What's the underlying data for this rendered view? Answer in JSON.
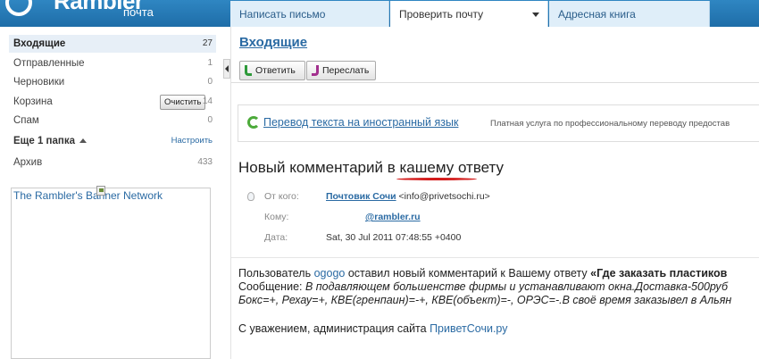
{
  "header": {
    "logo_word": "Rambler",
    "logo_sub": "почта",
    "tabs": {
      "write": "Написать письмо",
      "check": "Проверить почту",
      "address": "Адресная книга"
    }
  },
  "sidebar": {
    "folders": [
      {
        "label": "Входящие",
        "count": "27"
      },
      {
        "label": "Отправленные",
        "count": "1"
      },
      {
        "label": "Черновики",
        "count": "0"
      },
      {
        "label": "Корзина",
        "count": "14"
      },
      {
        "label": "Спам",
        "count": "0"
      }
    ],
    "clear_label": "Очистить",
    "more_folders": "Еще 1 папка",
    "setup_link": "Настроить",
    "archive": {
      "label": "Архив",
      "count": "433"
    },
    "banner_text": "The Rambler's Banner Network"
  },
  "main": {
    "title": "Входящие",
    "reply_label": "Ответить",
    "forward_label": "Переслать",
    "translate_link": "Перевод текста на иностранный язык",
    "translate_note": "Платная услуга по профессиональному переводу предостав",
    "subject_before": "Новый комментарий ",
    "subject_mark": "в кашему",
    "subject_after": " ответу",
    "from_label": "От кого:",
    "from_name": "Почтовик Сочи",
    "from_email": "<info@privetsochi.ru>",
    "to_label": "Кому:",
    "to_value": "@rambler.ru",
    "date_label": "Дата:",
    "date_value": "Sat, 30 Jul 2011 07:48:55 +0400",
    "body": {
      "l1_a": "Пользователь ",
      "l1_user": "ogogo",
      "l1_b": " оставил новый комментарий к Вашему ответу ",
      "l1_q": "«Где заказать пластиков",
      "l2_a": "Сообщение: ",
      "l2_i": "В подавляющем большенстве фирмы и устанавливают окна.Доставка-500руб",
      "l3_i": "Бокс=+, Рехау=+, КВЕ(гренпаин)=-+, КВЕ(объект)=-, ОРЭС=-.В своё время заказывел в Альян",
      "sign_a": "С уважением, администрация сайта ",
      "sign_link": "ПриветСочи.ру"
    }
  }
}
